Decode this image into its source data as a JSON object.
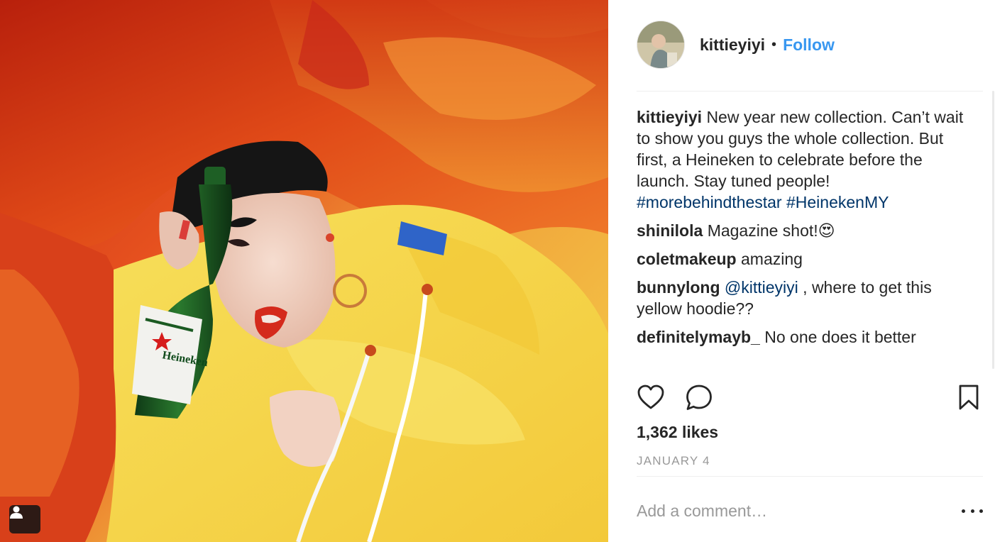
{
  "post": {
    "username": "kittieyiyi",
    "separator": "•",
    "follow_label": "Follow",
    "caption": {
      "username": "kittieyiyi",
      "text": "New year new collection. Can’t wait to show you guys the whole collection. But first, a Heineken to celebrate before the launch. Stay tuned people! ",
      "hashtag1": "#morebehindthestar",
      "hashtag2": "#HeinekenMY"
    },
    "comments": [
      {
        "username": "shinilola",
        "text": "Magazine shot!",
        "emoji": "😍"
      },
      {
        "username": "coletmakeup",
        "text": "amazing"
      },
      {
        "username": "bunnylong",
        "mention": "@kittieyiyi",
        "text": " , where to get this yellow hoodie??"
      },
      {
        "username": "definitelymayb_",
        "text": "No one does it better"
      }
    ],
    "likes_label": "1,362 likes",
    "date_label": "JANUARY 4",
    "comment_placeholder": "Add a comment…",
    "icons": {
      "like": "heart-icon",
      "comment": "speech-bubble-icon",
      "save": "bookmark-icon",
      "more": "ellipsis-icon",
      "tagged_people": "person-icon"
    }
  },
  "colors": {
    "follow": "#3897f0",
    "link": "#003569",
    "muted": "#999999",
    "text": "#262626"
  }
}
